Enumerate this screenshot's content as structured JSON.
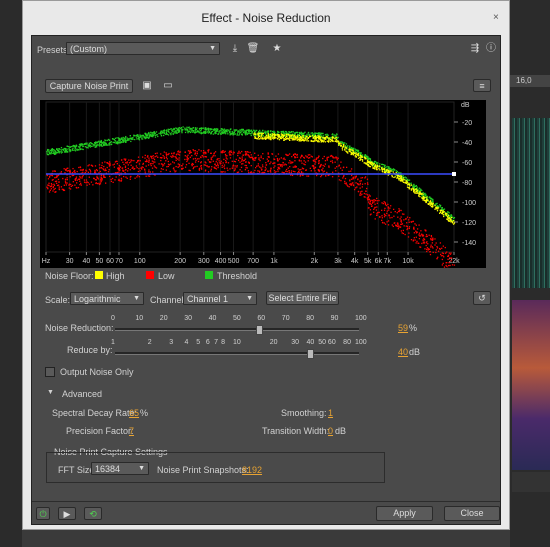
{
  "window": {
    "title": "Effect - Noise Reduction",
    "close": "×"
  },
  "background": {
    "ruler": "16,0"
  },
  "presets": {
    "label": "Presets:",
    "value": "(Custom)"
  },
  "capture": {
    "label": "Capture Noise Print"
  },
  "graph": {
    "unit": "dB",
    "y_ticks": [
      "-20",
      "-40",
      "-60",
      "-80",
      "-100",
      "-120",
      "-140"
    ],
    "x_ticks": [
      "Hz",
      "30",
      "40",
      "50",
      "60",
      "70",
      "100",
      "200",
      "300",
      "400",
      "500",
      "700",
      "1k",
      "2k",
      "3k",
      "4k",
      "5k",
      "6k",
      "7k",
      "10k",
      "22k"
    ],
    "threshold_db": -72,
    "colors": {
      "high": "#ffff00",
      "low": "#ff0000",
      "threshold": "#22cc22",
      "line": "#3a4cff"
    }
  },
  "legend": {
    "label": "Noise Floor:",
    "high": "High",
    "low": "Low",
    "threshold": "Threshold"
  },
  "scale": {
    "label": "Scale:",
    "value": "Logarithmic"
  },
  "channel": {
    "label": "Channel:",
    "value": "Channel 1"
  },
  "select_entire": {
    "label": "Select Entire File"
  },
  "noise_reduction": {
    "label": "Noise Reduction:",
    "ticks": [
      "0",
      "10",
      "20",
      "30",
      "40",
      "50",
      "60",
      "70",
      "80",
      "90",
      "100"
    ],
    "value": "59",
    "unit": "%",
    "level": 0.59
  },
  "reduce_by": {
    "label": "Reduce by:",
    "ticks": [
      "1",
      "2",
      "3",
      "4",
      "5",
      "6",
      "7",
      "8",
      "10",
      "20",
      "30",
      "40",
      "50",
      "60",
      "80",
      "100"
    ],
    "value": "40",
    "unit": "dB"
  },
  "output_noise": {
    "label": "Output Noise Only"
  },
  "advanced": {
    "label": "Advanced",
    "spectral_decay": {
      "label": "Spectral Decay Rate:",
      "value": "65",
      "unit": "%"
    },
    "smoothing": {
      "label": "Smoothing:",
      "value": "1"
    },
    "precision": {
      "label": "Precision Factor:",
      "value": "7"
    },
    "transition": {
      "label": "Transition Width:",
      "value": "0",
      "unit": "dB"
    }
  },
  "capture_settings": {
    "title": "Noise Print Capture Settings",
    "fft_label": "FFT Size:",
    "fft_value": "16384",
    "snapshots_label": "Noise Print Snapshots:",
    "snapshots_value": "8192"
  },
  "footer": {
    "apply": "Apply",
    "close": "Close"
  }
}
